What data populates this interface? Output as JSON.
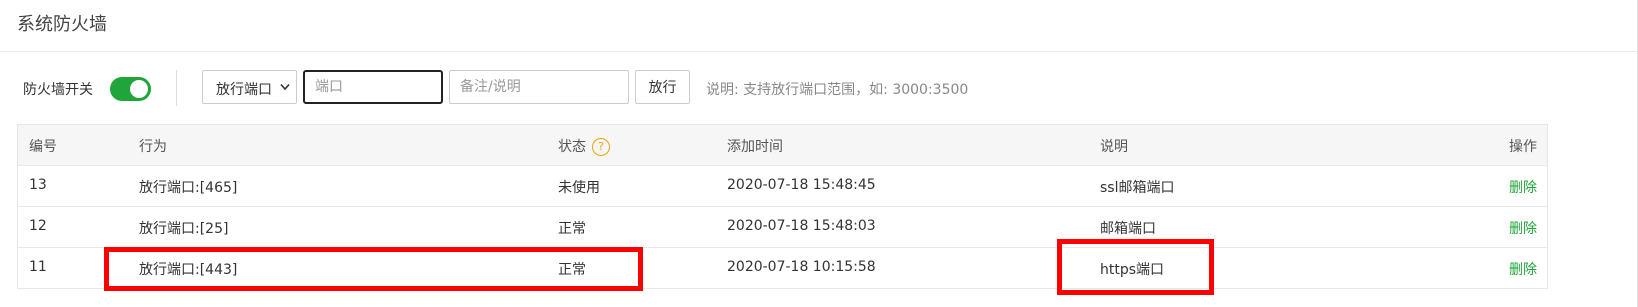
{
  "header": {
    "title": "系统防火墙"
  },
  "toolbar": {
    "firewall_label": "防火墙开关",
    "firewall_enabled": true,
    "select_value": "放行端口",
    "port_placeholder": "端口",
    "note_placeholder": "备注/说明",
    "allow_button": "放行",
    "hint": "说明: 支持放行端口范围，如: 3000:3500"
  },
  "table": {
    "headers": {
      "id": "编号",
      "action": "行为",
      "status": "状态",
      "status_help": "?",
      "time": "添加时间",
      "note": "说明",
      "op": "操作"
    },
    "rows": [
      {
        "id": "13",
        "action": "放行端口:[465]",
        "status": "未使用",
        "time": "2020-07-18 15:48:45",
        "note": "ssl邮箱端口",
        "op": "删除"
      },
      {
        "id": "12",
        "action": "放行端口:[25]",
        "status": "正常",
        "time": "2020-07-18 15:48:03",
        "note": "邮箱端口",
        "op": "删除"
      },
      {
        "id": "11",
        "action": "放行端口:[443]",
        "status": "正常",
        "time": "2020-07-18 10:15:58",
        "note": "https端口",
        "op": "删除"
      }
    ]
  },
  "colors": {
    "accent": "#20a53a",
    "highlight": "#ff0000",
    "help": "#f0a30a"
  }
}
